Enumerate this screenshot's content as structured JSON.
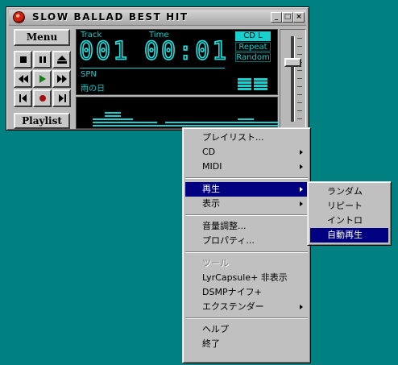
{
  "player": {
    "title": "SLOW  BALLAD  BEST  HIT",
    "titlebar_buttons": {
      "minimize": "_",
      "maximize": "□",
      "close": "×"
    },
    "menu_label": "Menu",
    "playlist_label": "Playlist",
    "controls": [
      "stop",
      "pause",
      "eject",
      "rewind",
      "play",
      "fast-forward",
      "previous",
      "record",
      "next"
    ],
    "display": {
      "track_label": "Track",
      "time_label": "Time",
      "track_value": "001",
      "time_value": "00:01",
      "line1": "SPN",
      "line2": "雨の日",
      "cd_badge": "CD L",
      "repeat_badge": "Repeat",
      "random_badge": "Random"
    },
    "spectrum_levels": [
      0,
      3,
      5,
      3,
      2,
      2,
      1,
      2,
      2,
      2,
      2,
      2,
      2,
      3,
      2,
      2
    ],
    "vu_bars": 4,
    "volume_level": 0.72,
    "colors": {
      "lcd_text": "#18c8c8",
      "lcd_bg": "#000000",
      "desktop": "#008080",
      "highlight": "#000080"
    }
  },
  "context_menu": {
    "items": [
      {
        "label": "プレイリスト...",
        "submenu": false
      },
      {
        "label": "CD",
        "submenu": true
      },
      {
        "label": "MIDI",
        "submenu": true
      },
      {
        "separator": true
      },
      {
        "label": "再生",
        "submenu": true,
        "highlighted": true
      },
      {
        "label": "表示",
        "submenu": true
      },
      {
        "separator": true
      },
      {
        "label": "音量調整...",
        "submenu": false
      },
      {
        "label": "プロパティ...",
        "submenu": false
      },
      {
        "separator": true
      },
      {
        "label": "ツール",
        "submenu": false,
        "disabled": true
      },
      {
        "label": "LyrCapsule+ 非表示",
        "submenu": false
      },
      {
        "label": "DSMPナイフ+",
        "submenu": false
      },
      {
        "label": "エクステンダー",
        "submenu": true
      },
      {
        "separator": true
      },
      {
        "label": "ヘルプ",
        "submenu": false
      },
      {
        "label": "終了",
        "submenu": false
      }
    ]
  },
  "play_submenu": {
    "items": [
      {
        "label": "ランダム"
      },
      {
        "label": "リピート"
      },
      {
        "label": "イントロ"
      },
      {
        "label": "自動再生",
        "highlighted": true
      }
    ]
  }
}
